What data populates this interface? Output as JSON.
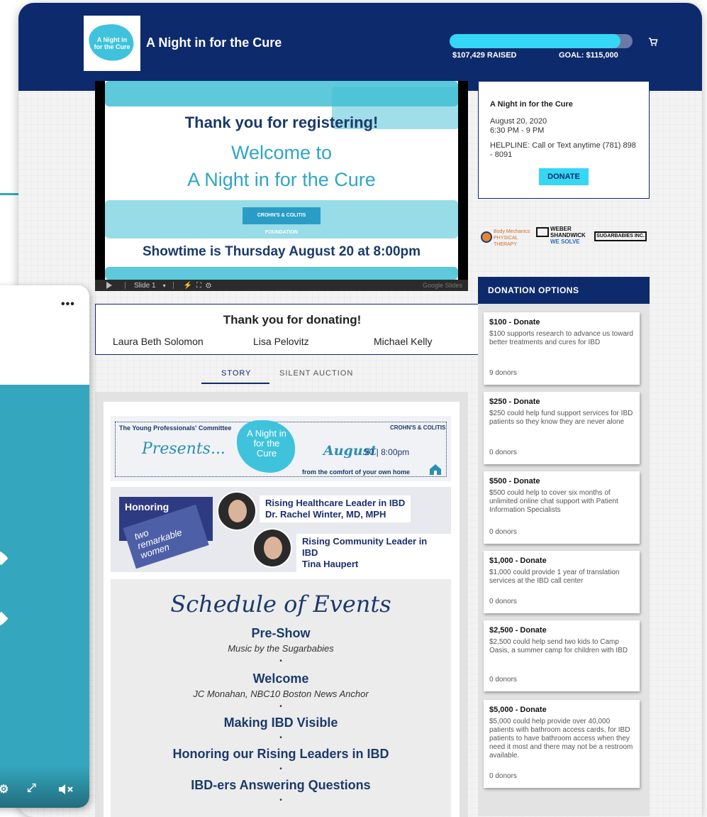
{
  "header": {
    "title": "A Night in for the Cure",
    "logo_text": "A Night in for the Cure",
    "raised": "$107,429 RAISED",
    "goal": "GOAL: $115,000",
    "progress_fraction": 0.934,
    "accent": "#35d7f5",
    "navy": "#0d2a6c"
  },
  "video": {
    "line1": "Thank you for registering!",
    "line2": "Welcome to",
    "line3": "A Night in for the Cure",
    "org": "CROHN'S & COLITIS FOUNDATION",
    "line4": "Showtime is Thursday August 20 at 8:00pm",
    "slide_label": "Slide 1",
    "brand": "Google Slides"
  },
  "thanks": {
    "title": "Thank you for donating!",
    "donors": [
      "Laura Beth Solomon",
      "Lisa Pelovitz",
      "Michael Kelly"
    ]
  },
  "tabs": {
    "story": "STORY",
    "auction": "SILENT AUCTION"
  },
  "banner": {
    "committee": "The Young Professionals' Committee",
    "presents": "Presents...",
    "splash": "A Night in for the Cure",
    "crohns": "CROHN'S & COLITIS",
    "august": "August",
    "time": "20 | 8:00pm",
    "comfort": "from the comfort of your own home"
  },
  "honoring": {
    "label": "Honoring",
    "subtitle": "two remarkable women",
    "honoree1_role": "Rising Healthcare Leader in IBD",
    "honoree1_name": "Dr. Rachel Winter, MD, MPH",
    "honoree2_role": "Rising Community Leader in IBD",
    "honoree2_name": "Tina Haupert"
  },
  "schedule": {
    "title": "Schedule of Events",
    "preshow": "Pre-Show",
    "preshow_sub": "Music by the Sugarbabies",
    "welcome": "Welcome",
    "welcome_sub": "JC Monahan, NBC10 Boston News Anchor",
    "item3": "Making IBD Visible",
    "item4": "Honoring our Rising Leaders in IBD",
    "item5": "IBD-ers Answering Questions",
    "dot": "•"
  },
  "event": {
    "name": "A Night in for the Cure",
    "date": "August 20, 2020",
    "time": "6:30 PM - 9 PM",
    "helpline": "HELPLINE: Call or Text anytime (781) 898 - 8091",
    "donate_label": "DONATE"
  },
  "sponsors": {
    "s1": "Body Mechanics PHYSICAL THERAPY",
    "s2": "WEBER SHANDWICK",
    "s2_tag": "WE SOLVE",
    "s3": "SUGARBABIES INC."
  },
  "donation": {
    "header": "DONATION OPTIONS",
    "options": [
      {
        "title": "$100 - Donate",
        "desc": "$100 supports research to advance us toward better treatments and cures for IBD",
        "donors": "9 donors"
      },
      {
        "title": "$250 - Donate",
        "desc": "$250 could help fund support services for IBD patients so they know they are never alone",
        "donors": "0 donors"
      },
      {
        "title": "$500 - Donate",
        "desc": "$500 could help to cover six months of unlimited online chat support with Patient Information Specialists",
        "donors": "0 donors"
      },
      {
        "title": "$1,000 - Donate",
        "desc": "$1,000 could provide 1 year of translation services at the IBD call center",
        "donors": "0 donors"
      },
      {
        "title": "$2,500 - Donate",
        "desc": "$2,500 could help send two kids to Camp Oasis, a summer camp for children with IBD",
        "donors": "0 donors"
      },
      {
        "title": "$5,000 - Donate",
        "desc": "$5,000 could help provide over 40,000 patients with bathroom access cards, for IBD patients to have bathroom access when they need it most and there may not be a restroom available.",
        "donors": "0 donors"
      }
    ]
  },
  "player": {
    "menu": "•••"
  }
}
